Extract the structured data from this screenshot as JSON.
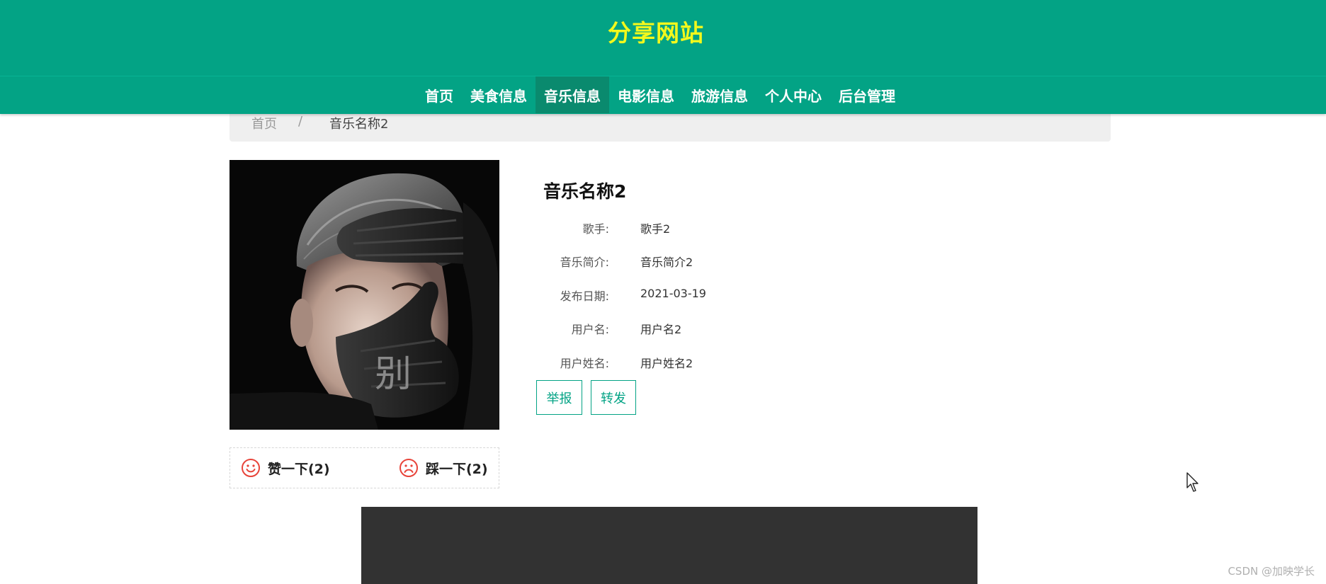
{
  "header": {
    "site_title": "分享网站",
    "nav": [
      {
        "label": "首页",
        "active": false
      },
      {
        "label": "美食信息",
        "active": false
      },
      {
        "label": "音乐信息",
        "active": true
      },
      {
        "label": "电影信息",
        "active": false
      },
      {
        "label": "旅游信息",
        "active": false
      },
      {
        "label": "个人中心",
        "active": false
      },
      {
        "label": "后台管理",
        "active": false
      }
    ]
  },
  "breadcrumb": {
    "home": "首页",
    "separator": "/",
    "current": "音乐名称2"
  },
  "cover": {
    "overlay_text": "别"
  },
  "votes": {
    "like_label": "赞一下(2)",
    "dislike_label": "踩一下(2)",
    "like_icon": "smile-icon",
    "dislike_icon": "frown-icon"
  },
  "detail": {
    "title": "音乐名称2",
    "fields": [
      {
        "label": "歌手:",
        "value": "歌手2"
      },
      {
        "label": "音乐简介:",
        "value": "音乐简介2"
      },
      {
        "label": "发布日期:",
        "value": "2021-03-19"
      },
      {
        "label": "用户名:",
        "value": "用户名2"
      },
      {
        "label": "用户姓名:",
        "value": "用户姓名2"
      }
    ],
    "report_label": "举报",
    "forward_label": "转发"
  },
  "watermark": "CSDN @加映学长",
  "colors": {
    "header_bg": "#03a385",
    "active_nav_bg": "#0a8a6e",
    "title_yellow": "#f3f81c",
    "accent": "#03a385",
    "vote_icon": "#e8443a",
    "player_bg": "#323232"
  }
}
